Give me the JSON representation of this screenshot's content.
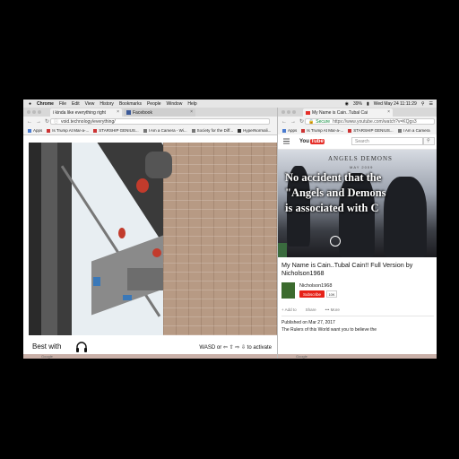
{
  "menubar": {
    "items": [
      "Chrome",
      "File",
      "Edit",
      "View",
      "History",
      "Bookmarks",
      "People",
      "Window",
      "Help"
    ],
    "datetime": "Wed May 24  11:11:29",
    "battery": "39%"
  },
  "left_window": {
    "tabs": [
      {
        "label": "i kinda like everything right"
      },
      {
        "label": "Facebook"
      }
    ],
    "url": "void.technology/everything/",
    "bookmarks": [
      "Apps",
      "Is Trump At Mar-a-...",
      "STARSHIP GENIUS...",
      "I Am a Camera - Wi...",
      "Society for the Diff...",
      "HyperNormali..."
    ],
    "best_with": "Best with",
    "controls_hint": "WASD or ⇦ ⇧ ⇨ ⇩ to activate",
    "dock_label": "Google"
  },
  "right_window": {
    "tab_label": "My Name is Cain..Tubal Cai",
    "secure": "Secure",
    "url": "https://www.youtube.com/watch?v=KQgs3",
    "bookmarks": [
      "Apps",
      "Is Trump At Mar-a-...",
      "STARSHIP GENIUS...",
      "I Am a Camera"
    ],
    "search_placeholder": "Search",
    "logo_you": "You",
    "logo_tube": "Tube",
    "poster_title": "ANGELS DEMONS",
    "poster_date": "MAY 2009",
    "caption_lines": [
      "No accident that the",
      "\"Angels and Demons",
      "is associated with C"
    ],
    "video_title": "My Name is Cain..Tubal Cain!! Full Version by Nicholson1968",
    "channel_name": "Nicholson1968",
    "subscribe": "Subscribe",
    "sub_count": "10K",
    "actions": [
      "+ Add to",
      "Share",
      "••• More"
    ],
    "published": "Published on Mar 27, 2017",
    "description": "The Rulers of this World want you to believe the",
    "dock_label": "Google"
  }
}
